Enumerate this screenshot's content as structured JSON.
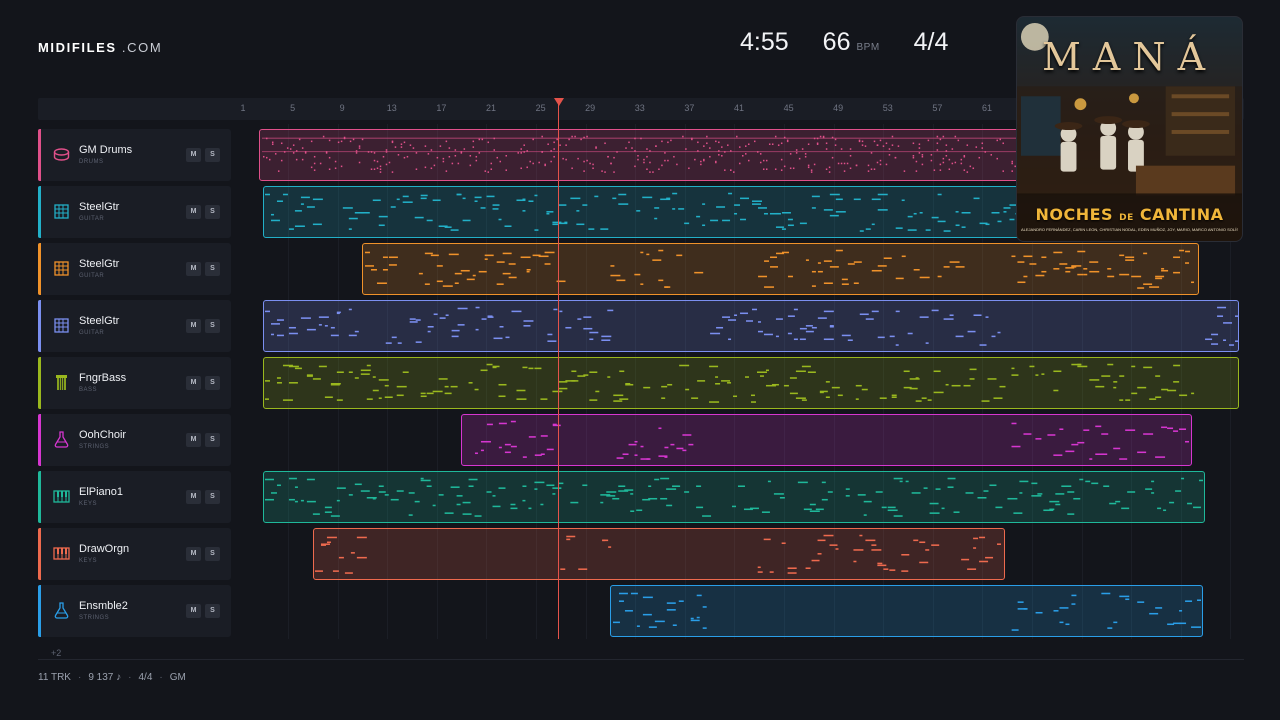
{
  "brand": {
    "name": "MIDIFILES",
    "suffix": ".COM"
  },
  "stats": {
    "duration": "4:55",
    "tempo": "66",
    "tempo_unit": "BPM",
    "time_signature": "4/4"
  },
  "ruler": {
    "ticks": [
      "1",
      "5",
      "9",
      "13",
      "17",
      "21",
      "25",
      "29",
      "33",
      "37",
      "41",
      "45",
      "49",
      "53",
      "57",
      "61"
    ]
  },
  "tracks": [
    {
      "name": "GM Drums",
      "category": "DRUMS",
      "icon": "drum-icon",
      "color": "#e0508a",
      "mute": "M",
      "solo": "S"
    },
    {
      "name": "SteelGtr",
      "category": "GUITAR",
      "icon": "guitar-fretboard-icon",
      "color": "#22b0c8",
      "mute": "M",
      "solo": "S"
    },
    {
      "name": "SteelGtr",
      "category": "GUITAR",
      "icon": "guitar-fretboard-icon",
      "color": "#f0922a",
      "mute": "M",
      "solo": "S"
    },
    {
      "name": "SteelGtr",
      "category": "GUITAR",
      "icon": "guitar-fretboard-icon",
      "color": "#7b8ff0",
      "mute": "M",
      "solo": "S"
    },
    {
      "name": "FngrBass",
      "category": "BASS",
      "icon": "bass-icon",
      "color": "#9ab81e",
      "mute": "M",
      "solo": "S"
    },
    {
      "name": "OohChoir",
      "category": "STRINGS",
      "icon": "flask-icon",
      "color": "#d636d0",
      "mute": "M",
      "solo": "S"
    },
    {
      "name": "ElPiano1",
      "category": "KEYS",
      "icon": "keyboard-icon",
      "color": "#1fb89a",
      "mute": "M",
      "solo": "S"
    },
    {
      "name": "DrawOrgn",
      "category": "KEYS",
      "icon": "keyboard-icon",
      "color": "#ee6a4e",
      "mute": "M",
      "solo": "S"
    },
    {
      "name": "Ensmble2",
      "category": "STRINGS",
      "icon": "flask-icon",
      "color": "#2a9ee8",
      "mute": "M",
      "solo": "S"
    }
  ],
  "more_tracks": "+2",
  "footer": {
    "tracks": "11 TRK",
    "notes": "9 137 ♪",
    "time_signature": "4/4",
    "standard": "GM"
  },
  "cover": {
    "artist": "MANÁ",
    "album_a": "NOCHES",
    "album_de": "DE",
    "album_b": "CANTINA",
    "credits": "ALEJANDRO FERNÁNDEZ, CARIN LEON, CHRISTIAN NODAL, EDEN MUÑOZ, JOY, MARIO, MARCO ANTONIO SOLÍS, PABLO ALBORÁN, SEBASTIÁN YATRA"
  }
}
